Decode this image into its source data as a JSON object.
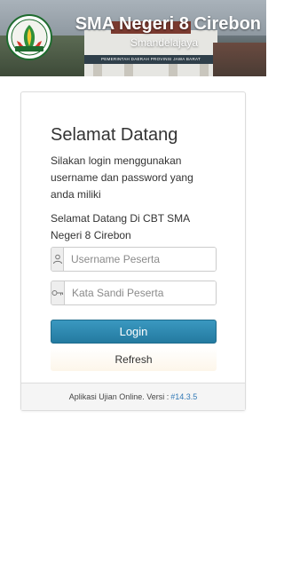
{
  "header": {
    "title": "SMA Negeri 8 Cirebon",
    "subtitle": "Smandelajaya",
    "logo_text": "SMA NEGERI 8 CIREBON",
    "building_banner": "PEMERINTAH DAERAH PROVINSI JAWA BARAT"
  },
  "login": {
    "title": "Selamat Datang",
    "intro": "Silakan login menggunakan username dan password yang anda miliki",
    "school_welcome": "Selamat Datang Di CBT SMA Negeri 8 Cirebon",
    "username_placeholder": "Username Peserta",
    "password_placeholder": "Kata Sandi Peserta",
    "login_label": "Login",
    "refresh_label": "Refresh"
  },
  "footer": {
    "text": "Aplikasi Ujian Online. Versi :",
    "version_link": "#14.3.5"
  },
  "icons": {
    "user": "user-icon",
    "key": "key-icon"
  },
  "colors": {
    "primary_button": "#2a86ad",
    "link": "#337ab7"
  }
}
